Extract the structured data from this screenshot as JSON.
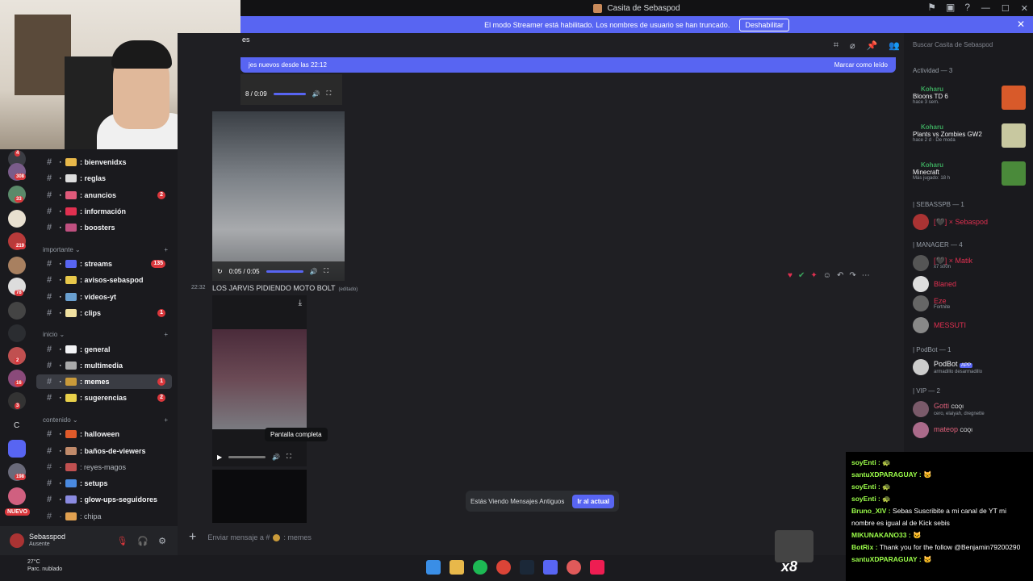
{
  "window": {
    "title": "Casita de Sebaspod",
    "controls": [
      "—",
      "☐",
      "✕"
    ]
  },
  "banner": {
    "text": "El modo Streamer está habilitado. Los nombres de usuario se han truncado.",
    "button": "Deshabilitar"
  },
  "header": {
    "channel": "es",
    "search_placeholder": "Buscar Casita de Sebaspod"
  },
  "newbar": {
    "text": "jes nuevos desde las 22:12",
    "action": "Marcar como leído"
  },
  "servers": {
    "badges": [
      "4",
      "308",
      "33",
      "219",
      "78",
      "2",
      "16",
      "3",
      "198"
    ],
    "letter": "C",
    "nuevo": "NUEVO"
  },
  "categories": {
    "importante": "importante",
    "inicio": "inicio",
    "contenido": "contenido"
  },
  "channels": [
    {
      "name": "bienvenidxs",
      "unread": true
    },
    {
      "name": "reglas",
      "unread": true
    },
    {
      "name": "anuncios",
      "unread": true,
      "badge": "2"
    },
    {
      "name": "información",
      "unread": true
    },
    {
      "name": "boosters",
      "unread": true
    },
    {
      "name": "streams",
      "unread": true,
      "badge": "135"
    },
    {
      "name": "avisos-sebaspod",
      "unread": true
    },
    {
      "name": "videos-yt",
      "unread": true
    },
    {
      "name": "clips",
      "unread": true,
      "badge": "1"
    },
    {
      "name": "general",
      "unread": true
    },
    {
      "name": "multimedia",
      "unread": true
    },
    {
      "name": "memes",
      "unread": true,
      "badge": "1",
      "active": true
    },
    {
      "name": "sugerencias",
      "unread": true,
      "badge": "2"
    },
    {
      "name": "halloween",
      "unread": true
    },
    {
      "name": "baños-de-viewers",
      "unread": true
    },
    {
      "name": "reyes-magos",
      "unread": false
    },
    {
      "name": "setups",
      "unread": true
    },
    {
      "name": "glow-ups-seguidores",
      "unread": true
    },
    {
      "name": "chipa",
      "unread": false
    }
  ],
  "user": {
    "name": "Sebasspod",
    "status": "Ausente"
  },
  "weather": {
    "temp": "27°C",
    "desc": "Parc. nublado"
  },
  "messages": {
    "video1_time": "8 / 0:09",
    "video2_time": "0:05 / 0:05",
    "timestamp": "22:32",
    "text": "LOS JARVIS PIDIENDO MOTO BOLT",
    "edited": "(editado)",
    "tooltip": "Pantalla completa"
  },
  "old_messages": {
    "text": "Estás Viendo Mensajes Antiguos",
    "button": "Ir al actual"
  },
  "composer": {
    "placeholder": "Enviar mensaje a #",
    "channel": ": memes"
  },
  "activity": {
    "title": "Actividad — 3",
    "items": [
      {
        "user": "Koharu",
        "game": "Bloons TD 6",
        "time": "hace 3 sem."
      },
      {
        "user": "Koharu",
        "game": "Plants vs Zombies GW2",
        "time": "hace 2 d",
        "extra": "De moda"
      },
      {
        "user": "Koharu",
        "game": "Minecraft",
        "time": "Más jugado: 18 h"
      }
    ]
  },
  "members": {
    "cat1": "| SEBASSPB — 1",
    "cat2": "| MANAGER — 4",
    "cat3": "| PodBot — 1",
    "cat4": "| VIP — 2",
    "list": [
      {
        "name": "[🖤] × Sebaspod",
        "sub": ""
      },
      {
        "name": "[🖤] × Matik",
        "sub": "x7 s00n"
      },
      {
        "name": "Blaned",
        "sub": ""
      },
      {
        "name": "Eze",
        "sub": "Fortnite"
      },
      {
        "name": "MESSUTI",
        "sub": ""
      },
      {
        "name": "PodBot",
        "sub": "armadillo desarmadillo",
        "tag": "APP"
      },
      {
        "name": "Gotti",
        "sub": "cero, elaiyah, dregnette",
        "tag": "COQI"
      },
      {
        "name": "mateop",
        "sub": "",
        "tag": "COQI"
      }
    ]
  },
  "chat": [
    {
      "user": "soyEnti :",
      "msg": "🐢"
    },
    {
      "user": "santuXDPARAGUAY :",
      "msg": "🐱"
    },
    {
      "user": "soyEnti :",
      "msg": "🐢"
    },
    {
      "user": "soyEnti :",
      "msg": "🐢"
    },
    {
      "user": "Bruno_XIV :",
      "msg": "Sebas Suscribite a mi canal de YT mi nombre es igual al de Kick sebis"
    },
    {
      "user": "MIKUNAKANO33 :",
      "msg": "🐱"
    },
    {
      "user": "BotRix :",
      "msg": "Thank you for the follow @Benjamin79200290"
    },
    {
      "user": "santuXDPARAGUAY :",
      "msg": "🐱"
    }
  ],
  "overlay": {
    "count": "x8"
  },
  "colors": {
    "accent": "#5865f2",
    "badge": "#da373c",
    "online": "#3ba55c"
  }
}
